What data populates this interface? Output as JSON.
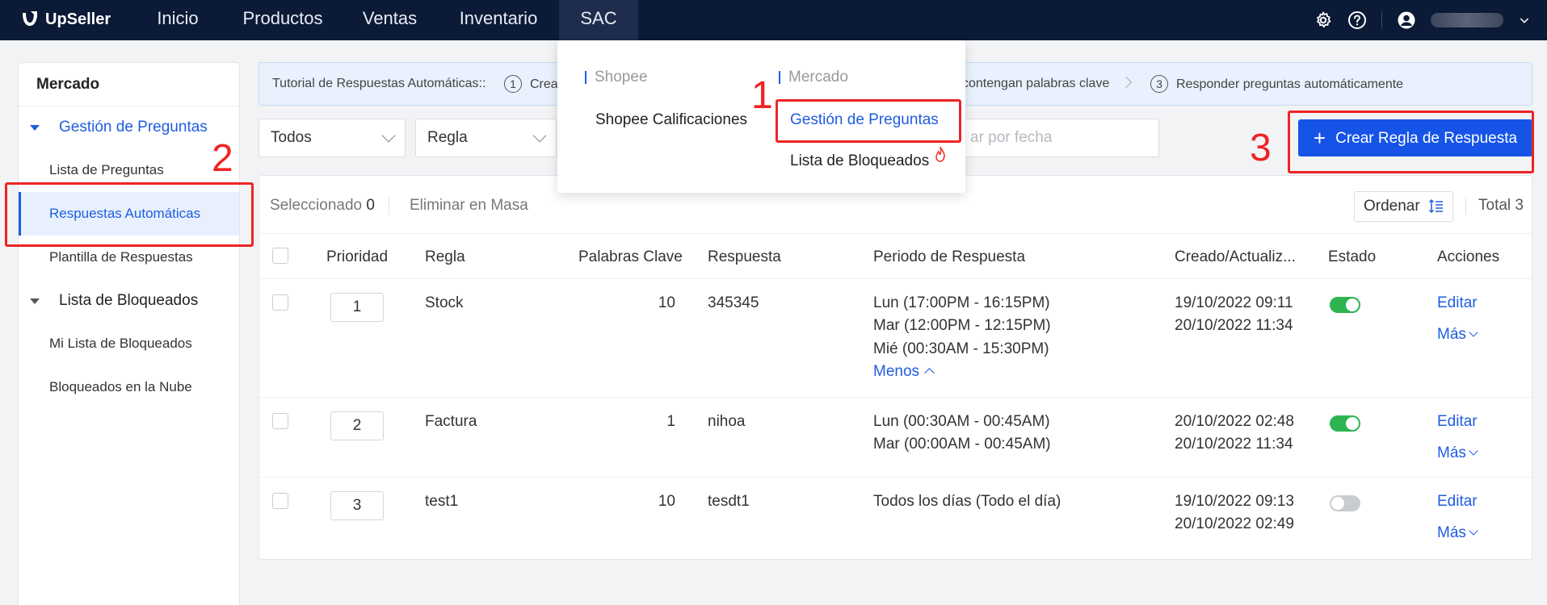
{
  "app": {
    "brand": "UpSeller"
  },
  "topnav": {
    "items": [
      {
        "label": "Inicio"
      },
      {
        "label": "Productos"
      },
      {
        "label": "Ventas"
      },
      {
        "label": "Inventario"
      },
      {
        "label": "SAC"
      }
    ],
    "active": "SAC"
  },
  "dropdown": {
    "col1_header": "Shopee",
    "col1_items": [
      "Shopee Calificaciones"
    ],
    "col2_header": "Mercado",
    "col2_items": [
      "Gestión de Preguntas",
      "Lista de Bloqueados"
    ]
  },
  "sidebar": {
    "title": "Mercado",
    "groups": [
      {
        "label": "Gestión de Preguntas",
        "items": [
          "Lista de Preguntas",
          "Respuestas Automáticas",
          "Plantilla de Respuestas"
        ]
      },
      {
        "label": "Lista de Bloqueados",
        "items": [
          "Mi Lista de Bloqueados",
          "Bloqueados en la Nube"
        ]
      }
    ],
    "active_item": "Respuestas Automáticas"
  },
  "tutorial": {
    "label": "Tutorial de Respuestas Automáticas::",
    "step1_num": "1",
    "step1": "Crea",
    "step2_fragment": "contengan palabras clave",
    "step3_num": "3",
    "step3": "Responder preguntas automáticamente"
  },
  "filters": {
    "status": "Todos",
    "rule": "Regla",
    "date_placeholder": "ar por fecha",
    "create_button": "Crear Regla de Respuesta"
  },
  "toolbar": {
    "selected_label": "Seleccionado",
    "selected_count": "0",
    "bulk_delete": "Eliminar en Masa",
    "sort": "Ordenar",
    "total": "Total 3"
  },
  "table": {
    "headers": [
      "Prioridad",
      "Regla",
      "Palabras Clave",
      "Respuesta",
      "Periodo de Respuesta",
      "Creado/Actualiz...",
      "Estado",
      "Acciones"
    ],
    "rows": [
      {
        "priority": "1",
        "rule": "Stock",
        "keywords": "10",
        "response": "345345",
        "periods": [
          "Lun (17:00PM - 16:15PM)",
          "Mar (12:00PM - 12:15PM)",
          "Mié (00:30AM - 15:30PM)"
        ],
        "less": "Menos",
        "created": "19/10/2022 09:11",
        "updated": "20/10/2022 11:34",
        "enabled": true,
        "edit": "Editar",
        "more": "Más"
      },
      {
        "priority": "2",
        "rule": "Factura",
        "keywords": "1",
        "response": "nihoa",
        "periods": [
          "Lun (00:30AM - 00:45AM)",
          "Mar (00:00AM - 00:45AM)"
        ],
        "created": "20/10/2022 02:48",
        "updated": "20/10/2022 11:34",
        "enabled": true,
        "edit": "Editar",
        "more": "Más"
      },
      {
        "priority": "3",
        "rule": "test1",
        "keywords": "10",
        "response": "tesdt1",
        "periods": [
          "Todos los días (Todo el día)"
        ],
        "created": "19/10/2022 09:13",
        "updated": "20/10/2022 02:49",
        "enabled": false,
        "edit": "Editar",
        "more": "Más"
      }
    ]
  },
  "annotations": {
    "n1": "1",
    "n2": "2",
    "n3": "3",
    "color": "#ee2424"
  },
  "colors": {
    "nav_bg": "#0b1a36",
    "accent": "#1f5ddf",
    "button": "#1654e8",
    "toggle_on": "#2db451"
  }
}
